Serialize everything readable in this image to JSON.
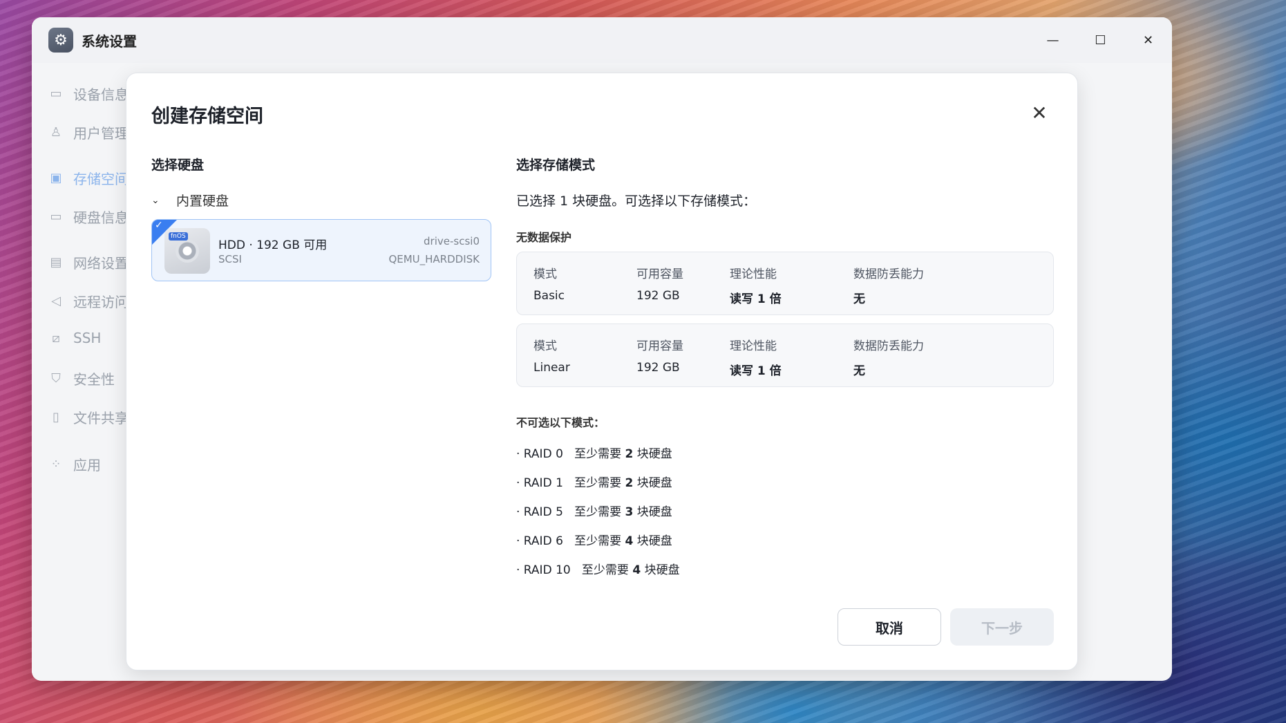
{
  "window": {
    "title": "系统设置",
    "controls": {
      "minimize": "—",
      "maximize": "☐",
      "close": "✕"
    }
  },
  "sidebar": {
    "items": [
      {
        "label": "设备信息",
        "icon": "device-icon"
      },
      {
        "label": "用户管理",
        "icon": "user-icon"
      },
      {
        "label": "存储空间",
        "icon": "storage-icon",
        "active": true
      },
      {
        "label": "硬盘信息",
        "icon": "disk-icon"
      },
      {
        "label": "网络设置",
        "icon": "network-icon"
      },
      {
        "label": "远程访问",
        "icon": "send-icon"
      },
      {
        "label": "SSH",
        "icon": "terminal-icon"
      },
      {
        "label": "安全性",
        "icon": "shield-icon"
      },
      {
        "label": "文件共享",
        "icon": "file-icon"
      },
      {
        "label": "应用",
        "icon": "apps-icon"
      }
    ]
  },
  "dialog": {
    "title": "创建存储空间",
    "close": "✕",
    "left": {
      "title": "选择硬盘",
      "group_label": "内置硬盘",
      "disk": {
        "tag": "fnOS",
        "name": "HDD · 192 GB 可用",
        "bus": "SCSI",
        "id": "drive-scsi0",
        "model": "QEMU_HARDDISK",
        "selected": true
      }
    },
    "right": {
      "title": "选择存储模式",
      "selected_text": "已选择 1 块硬盘。可选择以下存储模式：",
      "no_protection_label": "无数据保护",
      "columns": [
        "模式",
        "可用容量",
        "理论性能",
        "数据防丢能力"
      ],
      "modes": [
        {
          "mode": "Basic",
          "capacity": "192 GB",
          "performance": "读写 1 倍",
          "protection": "无"
        },
        {
          "mode": "Linear",
          "capacity": "192 GB",
          "performance": "读写 1 倍",
          "protection": "无"
        }
      ],
      "unavailable_label": "不可选以下模式：",
      "unavailable": [
        {
          "name": "· RAID 0",
          "pre": "至少需要",
          "count": "2",
          "post": "块硬盘"
        },
        {
          "name": "· RAID 1",
          "pre": "至少需要",
          "count": "2",
          "post": "块硬盘"
        },
        {
          "name": "· RAID 5",
          "pre": "至少需要",
          "count": "3",
          "post": "块硬盘"
        },
        {
          "name": "· RAID 6",
          "pre": "至少需要",
          "count": "4",
          "post": "块硬盘"
        },
        {
          "name": "· RAID 10",
          "pre": "至少需要",
          "count": "4",
          "post": "块硬盘"
        }
      ]
    },
    "buttons": {
      "cancel": "取消",
      "next": "下一步"
    }
  }
}
